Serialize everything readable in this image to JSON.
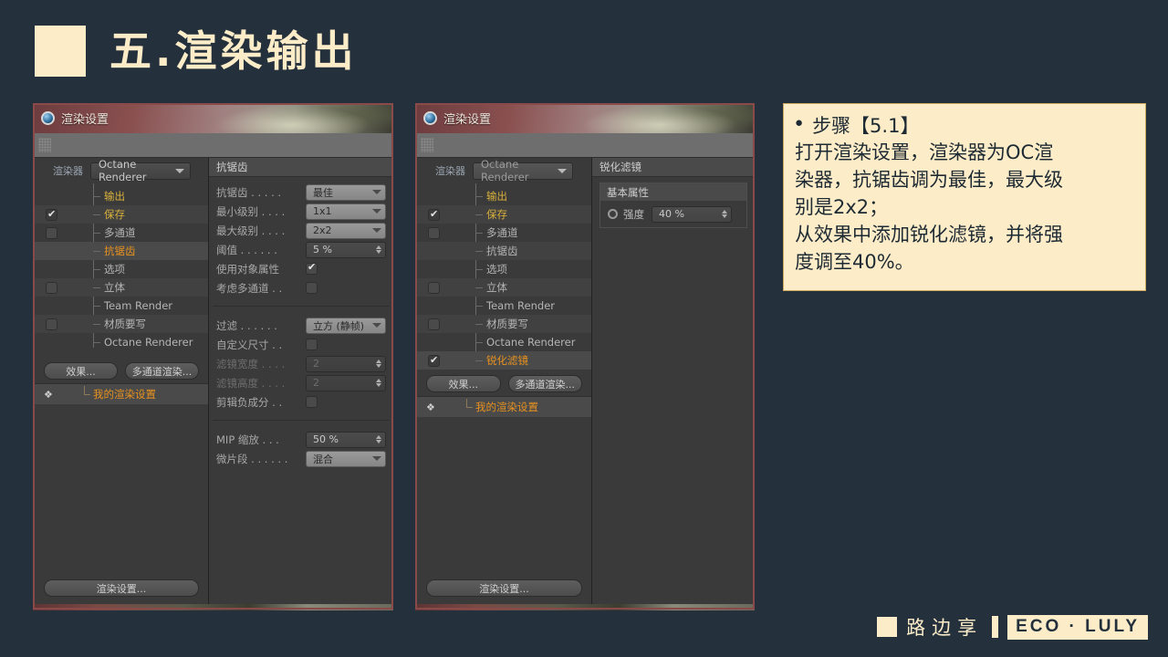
{
  "slide": {
    "title": "五.渲染输出"
  },
  "footer": {
    "cn": "路边享",
    "en": "ECO · LULY"
  },
  "note": {
    "bullet": "●",
    "heading": "步骤【5.1】",
    "line1": "打开渲染设置，渲染器为OC渲",
    "line2": "染器，抗锯齿调为最佳，最大级",
    "line3": "别是2x2；",
    "line4": "从效果中添加锐化滤镜，并将强",
    "line5": "度调至40%。"
  },
  "dialog1": {
    "title": "渲染设置",
    "renderer_label": "渲染器",
    "renderer_value": "Octane Renderer",
    "tree": [
      {
        "label": "输出",
        "color": "yellow",
        "checkbox": "none"
      },
      {
        "label": "保存",
        "color": "yellow",
        "checkbox": "on"
      },
      {
        "label": "多通道",
        "color": "normal",
        "checkbox": "off"
      },
      {
        "label": "抗锯齿",
        "color": "orange",
        "checkbox": "none"
      },
      {
        "label": "选项",
        "color": "normal",
        "checkbox": "none"
      },
      {
        "label": "立体",
        "color": "normal",
        "checkbox": "off"
      },
      {
        "label": "Team Render",
        "color": "normal",
        "checkbox": "none"
      },
      {
        "label": "材质要写",
        "color": "normal",
        "checkbox": "off"
      },
      {
        "label": "Octane Renderer",
        "color": "normal",
        "checkbox": "none"
      }
    ],
    "btn_effect": "效果...",
    "btn_multipass": "多通道渲染...",
    "my_settings": "我的渲染设置",
    "btn_bottom": "渲染设置...",
    "panel_title": "抗锯齿",
    "props": [
      {
        "label": "抗锯齿",
        "dots": ". . . . .",
        "type": "combo",
        "value": "最佳",
        "style": "gray"
      },
      {
        "label": "最小级别",
        "dots": ". . . .",
        "type": "combo",
        "value": "1x1",
        "style": "gray"
      },
      {
        "label": "最大级别",
        "dots": ". . . .",
        "type": "combo",
        "value": "2x2",
        "style": "gray"
      },
      {
        "label": "阈值",
        "dots": ". . . . . .",
        "type": "spin",
        "value": "5 %",
        "style": "normal"
      },
      {
        "label": "使用对象属性",
        "dots": "",
        "type": "check",
        "value": "on",
        "style": "normal"
      },
      {
        "label": "考虑多通道",
        "dots": ". .",
        "type": "check",
        "value": "off",
        "style": "normal"
      }
    ],
    "props2": [
      {
        "label": "过滤",
        "dots": ". . . . . .",
        "type": "combo",
        "value": "立方 (静帧)",
        "style": "gray"
      },
      {
        "label": "自定义尺寸",
        "dots": ". .",
        "type": "check",
        "value": "off",
        "style": "normal"
      },
      {
        "label": "滤镜宽度",
        "dots": ". . . .",
        "type": "spin",
        "value": "2",
        "style": "dim"
      },
      {
        "label": "滤镜高度",
        "dots": ". . . .",
        "type": "spin",
        "value": "2",
        "style": "dim"
      },
      {
        "label": "剪辑负成分",
        "dots": ". .",
        "type": "check",
        "value": "off",
        "style": "normal"
      }
    ],
    "props3": [
      {
        "label": "MIP 缩放",
        "dots": ". . .",
        "type": "spin",
        "value": "50 %",
        "style": "normal"
      },
      {
        "label": "微片段",
        "dots": ". . . . . .",
        "type": "combo",
        "value": "混合",
        "style": "gray"
      }
    ]
  },
  "dialog2": {
    "title": "渲染设置",
    "renderer_label": "渲染器",
    "renderer_value": "Octane Renderer",
    "tree": [
      {
        "label": "输出",
        "color": "yellow",
        "checkbox": "none"
      },
      {
        "label": "保存",
        "color": "yellow",
        "checkbox": "on"
      },
      {
        "label": "多通道",
        "color": "normal",
        "checkbox": "off"
      },
      {
        "label": "抗锯齿",
        "color": "normal",
        "checkbox": "none"
      },
      {
        "label": "选项",
        "color": "normal",
        "checkbox": "none"
      },
      {
        "label": "立体",
        "color": "normal",
        "checkbox": "off"
      },
      {
        "label": "Team Render",
        "color": "normal",
        "checkbox": "none"
      },
      {
        "label": "材质要写",
        "color": "normal",
        "checkbox": "off"
      },
      {
        "label": "Octane Renderer",
        "color": "normal",
        "checkbox": "none"
      },
      {
        "label": "锐化滤镜",
        "color": "orange",
        "checkbox": "on"
      }
    ],
    "btn_effect": "效果...",
    "btn_multipass": "多通道渲染...",
    "my_settings": "我的渲染设置",
    "btn_bottom": "渲染设置...",
    "panel_title": "锐化滤镜",
    "sub_title": "基本属性",
    "strength_label": "强度",
    "strength_value": "40 %"
  }
}
